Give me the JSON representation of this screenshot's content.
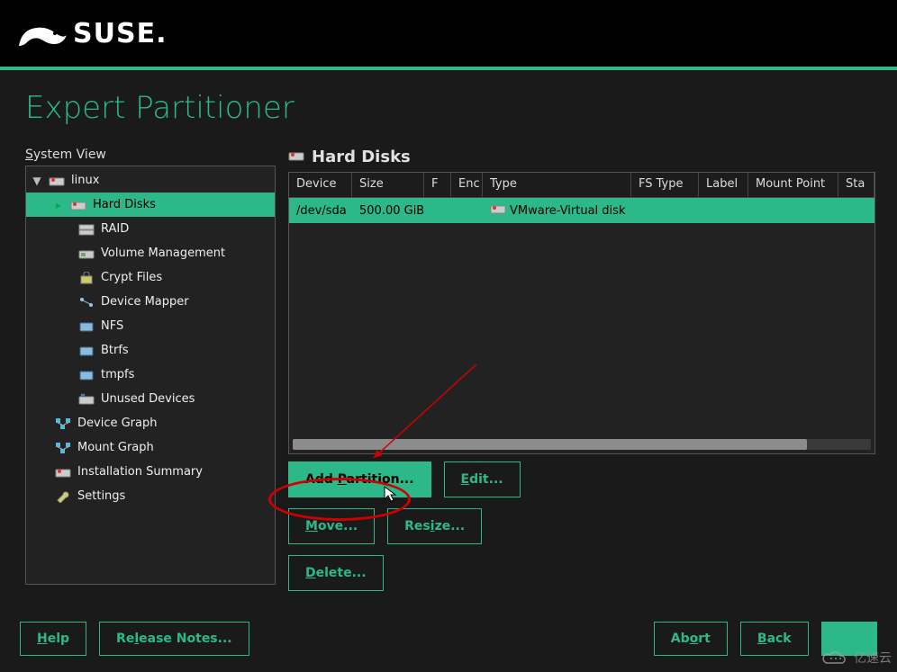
{
  "brand": {
    "name": "SUSE."
  },
  "page_title": "Expert Partitioner",
  "tree_label": {
    "pre": "S",
    "rest": "ystem View"
  },
  "tree": {
    "root": "linux",
    "items": [
      {
        "label": "Hard Disks",
        "selected": true
      },
      {
        "label": "RAID"
      },
      {
        "label": "Volume Management"
      },
      {
        "label": "Crypt Files"
      },
      {
        "label": "Device Mapper"
      },
      {
        "label": "NFS"
      },
      {
        "label": "Btrfs"
      },
      {
        "label": "tmpfs"
      },
      {
        "label": "Unused Devices"
      }
    ],
    "tail": [
      {
        "label": "Device Graph"
      },
      {
        "label": "Mount Graph"
      },
      {
        "label": "Installation Summary"
      },
      {
        "label": "Settings"
      }
    ]
  },
  "panel": {
    "title": "Hard Disks",
    "columns": [
      "Device",
      "Size",
      "F",
      "Enc",
      "Type",
      "FS Type",
      "Label",
      "Mount Point",
      "Sta"
    ],
    "rows": [
      {
        "device": "/dev/sda",
        "size": "500.00 GiB",
        "f": "",
        "enc": "",
        "type": "VMware-Virtual disk",
        "fstype": "",
        "label": "",
        "mount": "",
        "sta": ""
      }
    ]
  },
  "buttons": {
    "add_partition": {
      "pre": "Add ",
      "u": "P",
      "post": "artition..."
    },
    "edit": {
      "u": "E",
      "post": "dit..."
    },
    "move": {
      "u": "M",
      "post": "ove..."
    },
    "resize": {
      "pre": "Res",
      "u": "i",
      "post": "ze..."
    },
    "delete": {
      "u": "D",
      "post": "elete..."
    }
  },
  "bottom": {
    "help": {
      "u": "H",
      "post": "elp"
    },
    "release_notes": {
      "pre": "Re",
      "u": "l",
      "post": "ease Notes..."
    },
    "abort": {
      "pre": "Ab",
      "u": "o",
      "post": "rt"
    },
    "back": {
      "u": "B",
      "post": "ack"
    }
  },
  "watermark": "亿速云"
}
